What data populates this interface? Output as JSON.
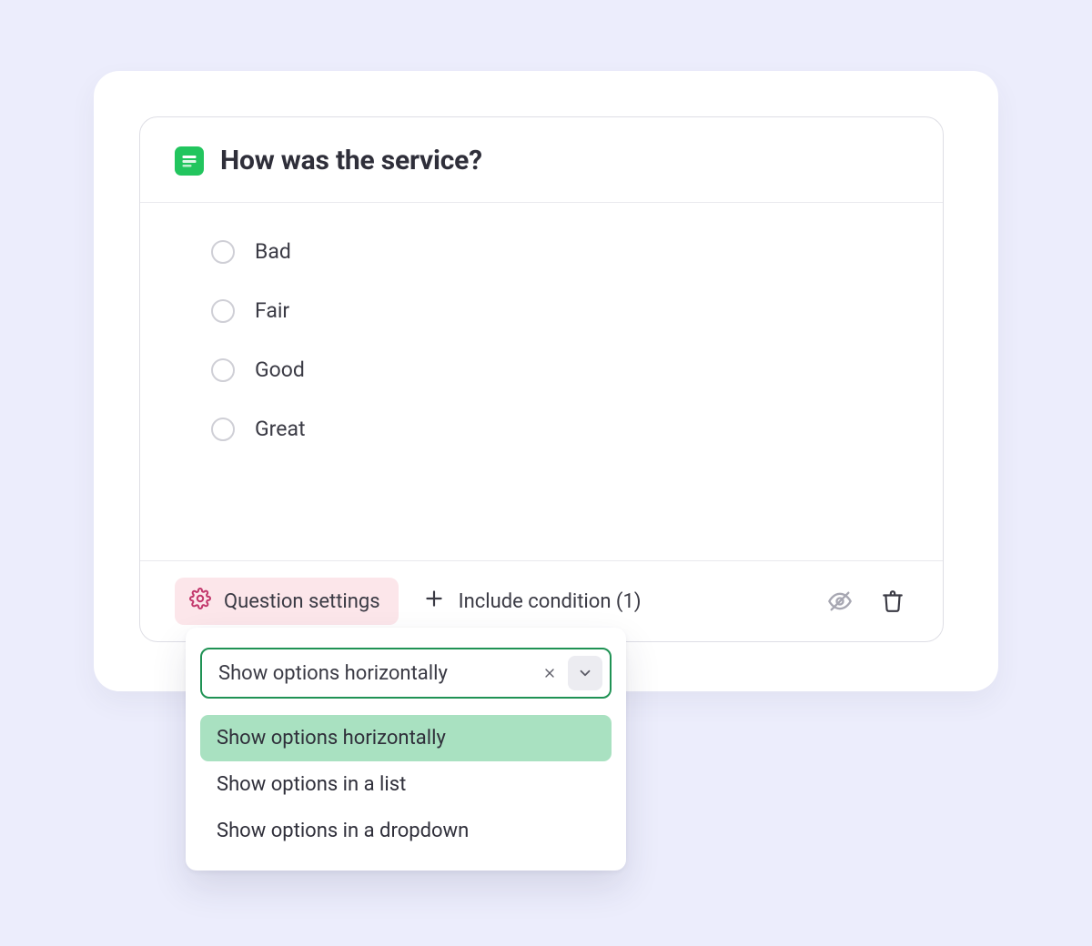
{
  "question": {
    "title": "How was the service?",
    "options": [
      "Bad",
      "Fair",
      "Good",
      "Great"
    ]
  },
  "footer": {
    "settings_label": "Question settings",
    "include_condition_label": "Include condition (1)"
  },
  "settings_popover": {
    "selected": "Show options horizontally",
    "options": [
      "Show options horizontally",
      "Show options in a list",
      "Show options in a dropdown"
    ]
  }
}
